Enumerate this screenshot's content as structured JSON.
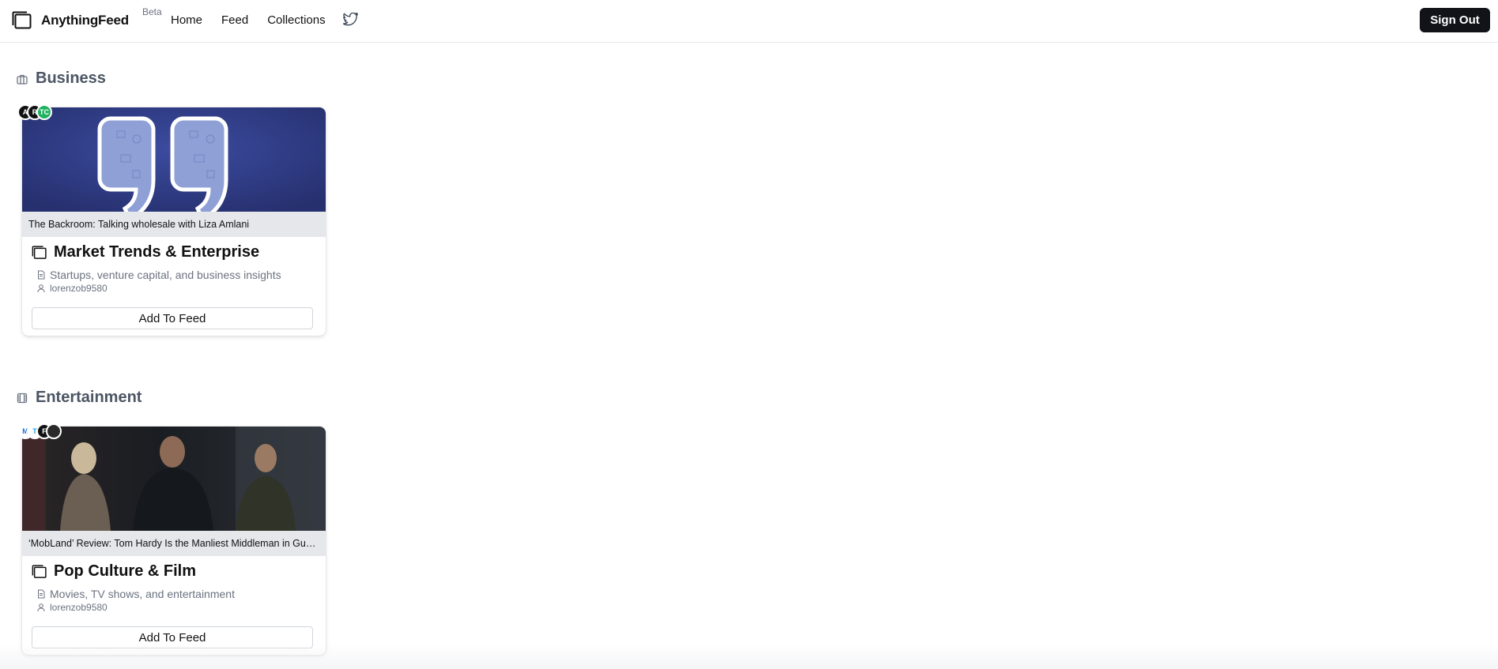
{
  "header": {
    "brand": "AnythingFeed",
    "badge": "Beta",
    "nav": [
      "Home",
      "Feed",
      "Collections"
    ],
    "twitter_icon": "twitter-icon",
    "sign_out": "Sign Out"
  },
  "sections": [
    {
      "title": "Business",
      "icon": "briefcase-icon",
      "card": {
        "caption": "The Backroom: Talking wholesale with Liza Amlani",
        "title": "Market Trends & Enterprise",
        "description": "Startups, venture capital, and business insights",
        "owner": "lorenzob9580",
        "button": "Add To Feed",
        "source_avatars": [
          "A",
          "R",
          "TC"
        ]
      }
    },
    {
      "title": "Entertainment",
      "icon": "film-icon",
      "card": {
        "caption": "‘MobLand’ Review: Tom Hardy Is the Manliest Middleman in Guy Ritchie’s Crime Drama",
        "title": "Pop Culture & Film",
        "description": "Movies, TV shows, and entertainment",
        "owner": "lorenzob9580",
        "button": "Add To Feed",
        "source_avatars": [
          "M",
          "T",
          "F",
          ""
        ]
      }
    }
  ],
  "colors": {
    "accent_dark": "#111318",
    "muted_text": "#6b7280",
    "section_title": "#4b5563",
    "caption_bg": "#e5e7eb",
    "business_thumb": "#2e3a80"
  }
}
